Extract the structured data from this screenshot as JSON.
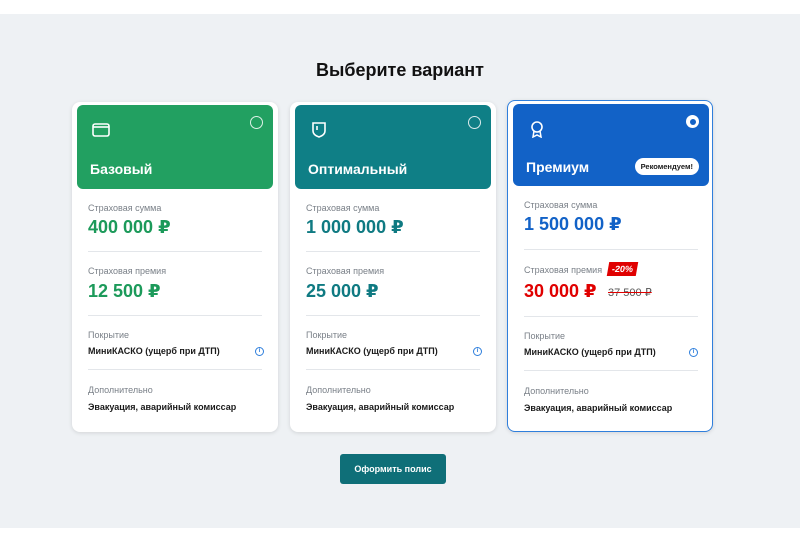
{
  "page": {
    "title": "Выберите вариант"
  },
  "labels": {
    "sum": "Страховая сумма",
    "premium": "Страховая премия",
    "coverage": "Покрытие",
    "extra": "Дополнительно"
  },
  "plans": [
    {
      "name": "Базовый",
      "color": "#22a061",
      "sum": "400 000 ₽",
      "premium": "12 500 ₽",
      "coverage": "МиниКАСКО (ущерб при ДТП)",
      "extra": "Эвакуация, аварийный комиссар",
      "selected": false
    },
    {
      "name": "Оптимальный",
      "color": "#0f7f86",
      "sum": "1 000 000 ₽",
      "premium": "25 000 ₽",
      "coverage": "МиниКАСКО (ущерб при ДТП)",
      "extra": "Эвакуация, аварийный комиссар",
      "selected": false
    },
    {
      "name": "Премиум",
      "color": "#1262c7",
      "badge": "Рекомендуем!",
      "sum": "1 500 000 ₽",
      "discount": "-20%",
      "premium": "30 000 ₽",
      "old_premium": "37 500 ₽",
      "coverage": "МиниКАСКО (ущерб при ДТП)",
      "extra": "Эвакуация, аварийный комиссар",
      "selected": true
    }
  ],
  "icons": [
    "wallet-icon",
    "shield-icon",
    "award-icon",
    "info-icon"
  ],
  "submit_label": "Оформить полис"
}
